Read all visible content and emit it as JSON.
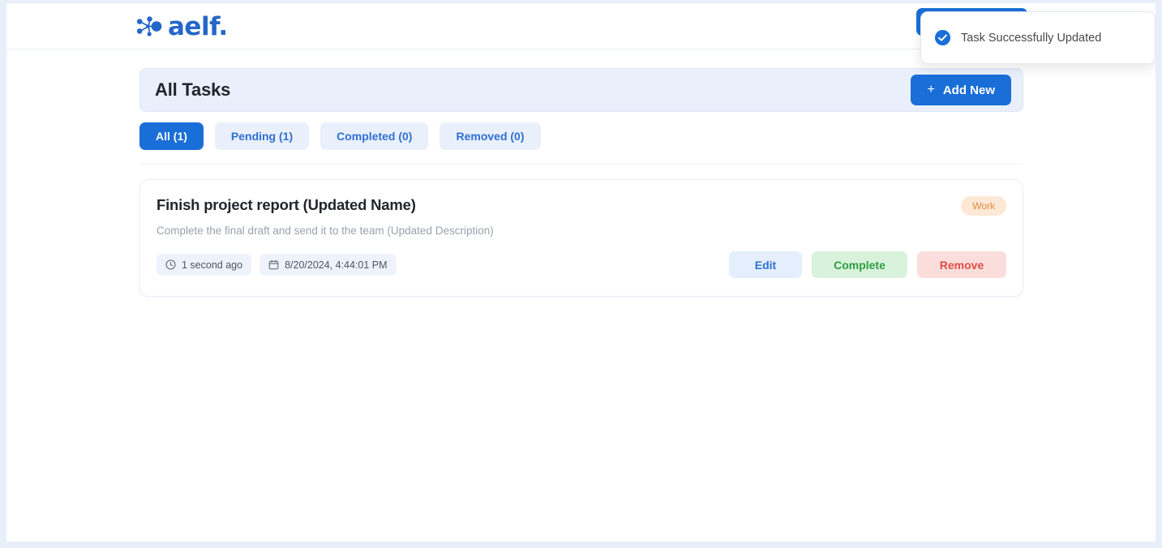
{
  "brand": {
    "mark_icon": "aelf-network-dots-icon",
    "word": "aelf."
  },
  "toast": {
    "icon": "check-circle-icon",
    "message": "Task Successfully Updated",
    "accent_color": "#1a6ed8"
  },
  "header": {
    "title": "All Tasks",
    "add_button": {
      "plus": "+",
      "label": "Add New"
    }
  },
  "tabs": [
    {
      "label": "All (1)",
      "active": true
    },
    {
      "label": "Pending (1)",
      "active": false
    },
    {
      "label": "Completed (0)",
      "active": false
    },
    {
      "label": "Removed (0)",
      "active": false
    }
  ],
  "task": {
    "name": "Finish project report (Updated Name)",
    "description": "Complete the final draft and send it to the team (Updated Description)",
    "tag": "Work",
    "meta": {
      "relative_time": "1 second ago",
      "relative_time_icon": "clock-icon",
      "timestamp": "8/20/2024, 4:44:01 PM",
      "timestamp_icon": "calendar-icon"
    },
    "actions": {
      "edit": "Edit",
      "complete": "Complete",
      "remove": "Remove"
    }
  },
  "colors": {
    "primary": "#1a6ed8",
    "header_bg": "#e9f0fb",
    "tag_text": "#e08a3e",
    "tag_bg": "#fde8d6",
    "complete_text": "#2f9e44",
    "remove_text": "#e14b45"
  }
}
